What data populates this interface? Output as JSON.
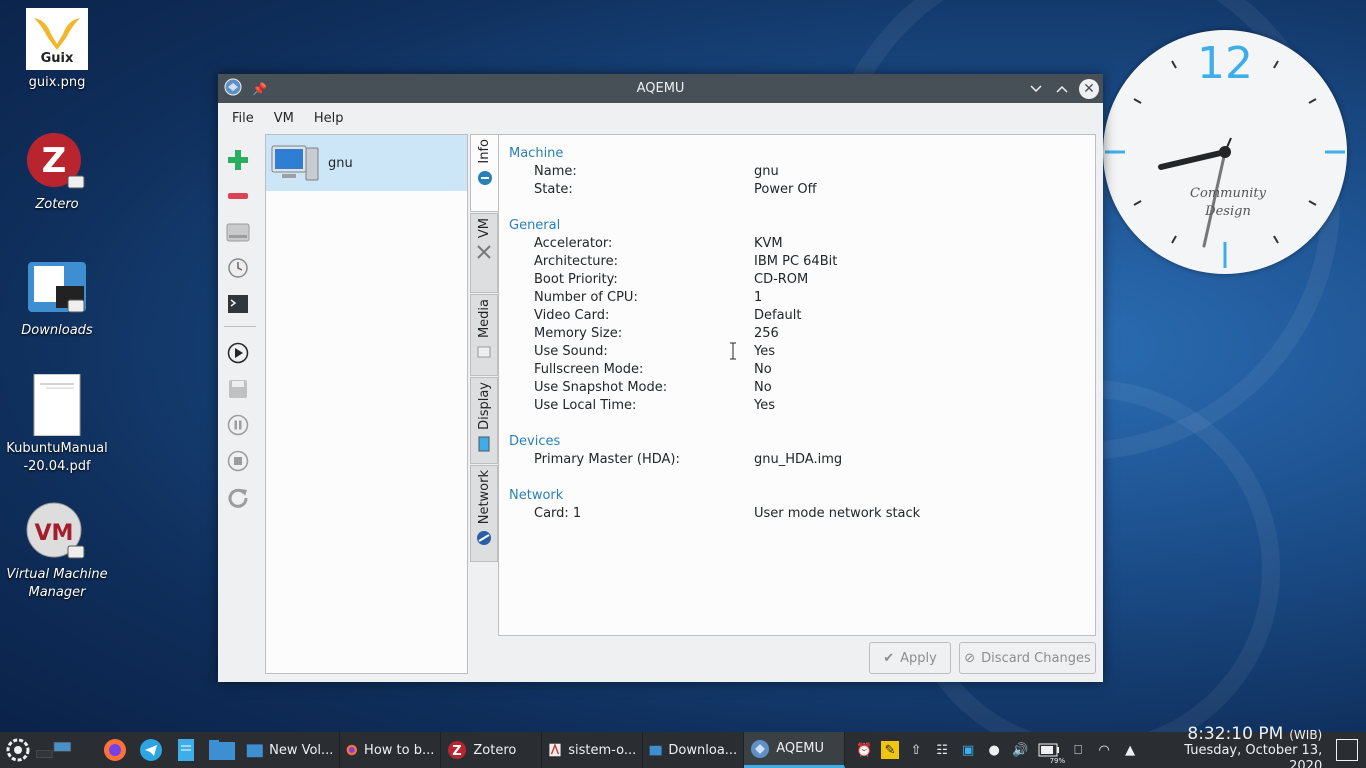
{
  "desktop": {
    "icons": [
      {
        "label": "guix.png",
        "badge": "Guix"
      },
      {
        "label": "Zotero"
      },
      {
        "label": "Downloads"
      },
      {
        "label_line1": "KubuntuManual",
        "label_line2": "-20.04.pdf"
      },
      {
        "label_line1": "Virtual Machine",
        "label_line2": "Manager"
      }
    ]
  },
  "clock_widget": {
    "numeral": "12",
    "brand_line1": "Community",
    "brand_line2": "Design"
  },
  "window": {
    "title": "AQEMU",
    "menu": [
      "File",
      "VM",
      "Help"
    ],
    "vm_list": [
      {
        "name": "gnu"
      }
    ],
    "tabs": [
      "Info",
      "VM",
      "Media",
      "Display",
      "Network"
    ],
    "info": {
      "machine": {
        "title": "Machine",
        "rows": [
          {
            "k": "Name:",
            "v": "gnu"
          },
          {
            "k": "State:",
            "v": "Power Off"
          }
        ]
      },
      "general": {
        "title": "General",
        "rows": [
          {
            "k": "Accelerator:",
            "v": "KVM"
          },
          {
            "k": "Architecture:",
            "v": "IBM PC 64Bit"
          },
          {
            "k": "Boot Priority:",
            "v": "CD-ROM"
          },
          {
            "k": "Number of CPU:",
            "v": "1"
          },
          {
            "k": "Video Card:",
            "v": "Default"
          },
          {
            "k": "Memory Size:",
            "v": "256"
          },
          {
            "k": "Use Sound:",
            "v": "Yes"
          },
          {
            "k": "Fullscreen Mode:",
            "v": "No"
          },
          {
            "k": "Use Snapshot Mode:",
            "v": "No"
          },
          {
            "k": "Use Local Time:",
            "v": "Yes"
          }
        ]
      },
      "devices": {
        "title": "Devices",
        "rows": [
          {
            "k": "Primary Master (HDA):",
            "v": "gnu_HDA.img"
          }
        ]
      },
      "network": {
        "title": "Network",
        "rows": [
          {
            "k": "Card: 1",
            "v": "User mode network stack"
          }
        ]
      }
    },
    "buttons": {
      "apply": "Apply",
      "discard": "Discard Changes"
    }
  },
  "taskbar": {
    "tasks": [
      {
        "label": "New Vol..."
      },
      {
        "label": "How to b..."
      },
      {
        "label": "Zotero"
      },
      {
        "label": "sistem-o..."
      },
      {
        "label": "Downloa..."
      },
      {
        "label": "AQEMU"
      }
    ],
    "battery": "79%",
    "time": "8:32:10 PM",
    "timezone": "(WIB)",
    "date": "Tuesday, October 13, 2020"
  },
  "colors": {
    "accent": "#3daee9",
    "section_title": "#2980b9",
    "titlebar": "#475057",
    "taskbar": "#2a2e32"
  }
}
